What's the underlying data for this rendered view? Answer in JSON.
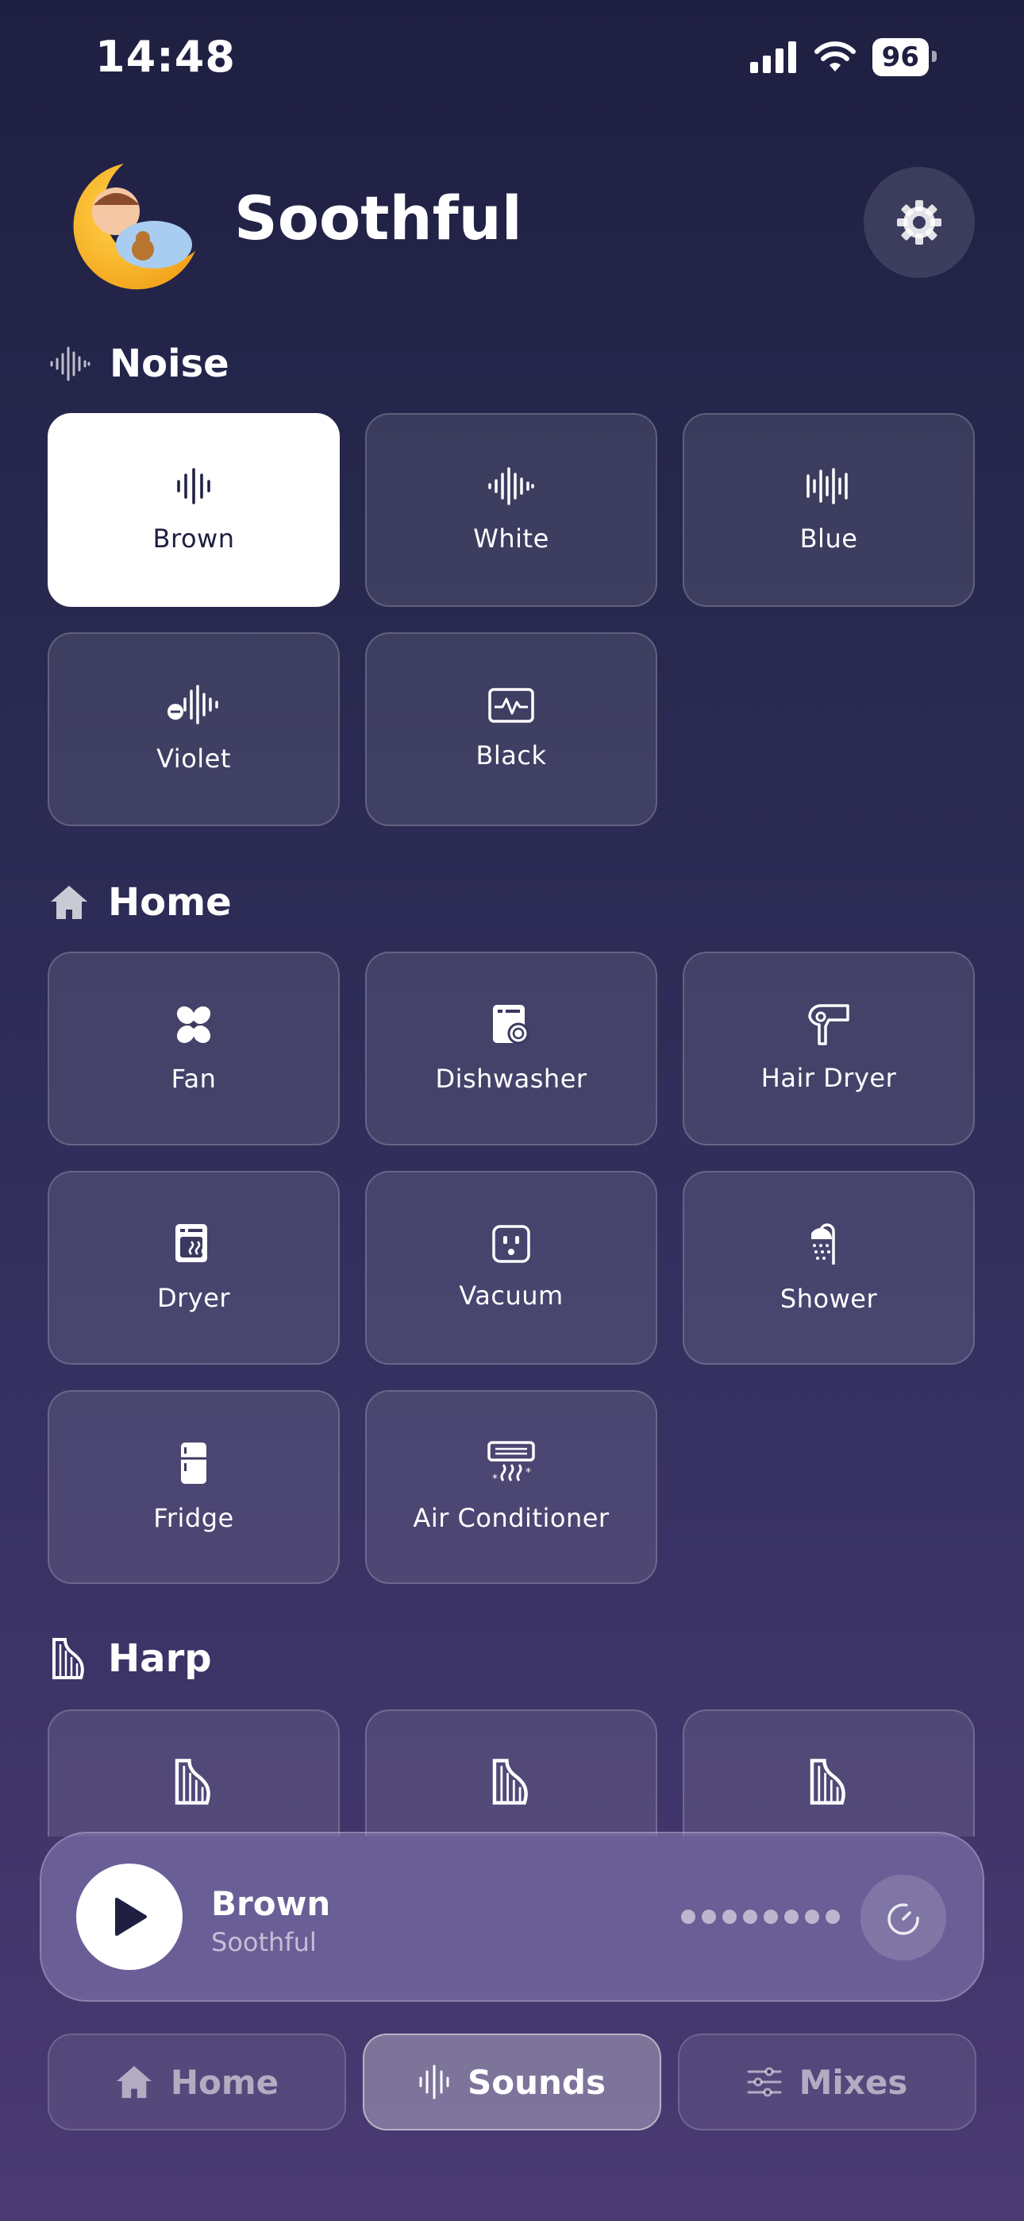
{
  "status_bar": {
    "time": "14:48",
    "battery": "96",
    "signal_icon": "cellular-signal-icon",
    "wifi_icon": "wifi-icon"
  },
  "header": {
    "app_name": "Soothful",
    "logo_icon": "sleeping-baby-moon-logo",
    "settings_icon": "gear-icon"
  },
  "sections": {
    "noise": {
      "title": "Noise",
      "icon": "waveform-icon",
      "items": [
        {
          "label": "Brown",
          "icon": "waveform-narrow-icon",
          "selected": true
        },
        {
          "label": "White",
          "icon": "waveform-icon"
        },
        {
          "label": "Blue",
          "icon": "waveform-dense-icon"
        },
        {
          "label": "Violet",
          "icon": "waveform-minus-icon"
        },
        {
          "label": "Black",
          "icon": "waveform-box-icon"
        }
      ]
    },
    "home": {
      "title": "Home",
      "icon": "house-icon",
      "items": [
        {
          "label": "Fan",
          "icon": "fan-icon"
        },
        {
          "label": "Dishwasher",
          "icon": "dishwasher-icon"
        },
        {
          "label": "Hair Dryer",
          "icon": "hair-dryer-icon"
        },
        {
          "label": "Dryer",
          "icon": "dryer-icon"
        },
        {
          "label": "Vacuum",
          "icon": "outlet-icon"
        },
        {
          "label": "Shower",
          "icon": "shower-icon"
        },
        {
          "label": "Fridge",
          "icon": "fridge-icon"
        },
        {
          "label": "Air Conditioner",
          "icon": "air-conditioner-icon"
        }
      ]
    },
    "harp": {
      "title": "Harp",
      "icon": "harp-icon",
      "items": [
        {
          "icon": "harp-icon"
        },
        {
          "icon": "harp-icon"
        },
        {
          "icon": "harp-icon"
        }
      ]
    }
  },
  "now_playing": {
    "title": "Brown",
    "subtitle": "Soothful",
    "play_icon": "play-icon",
    "timer_icon": "timer-icon",
    "volume_level_dots": 8
  },
  "tab_bar": [
    {
      "label": "Home",
      "icon": "house-icon",
      "active": false
    },
    {
      "label": "Sounds",
      "icon": "waveform-icon",
      "active": true
    },
    {
      "label": "Mixes",
      "icon": "sliders-icon",
      "active": false
    }
  ],
  "colors": {
    "background_top": "#1f1f42",
    "background_bottom": "#4a3a73",
    "selected_tile": "#ffffff",
    "selected_text": "#1f1f42"
  }
}
